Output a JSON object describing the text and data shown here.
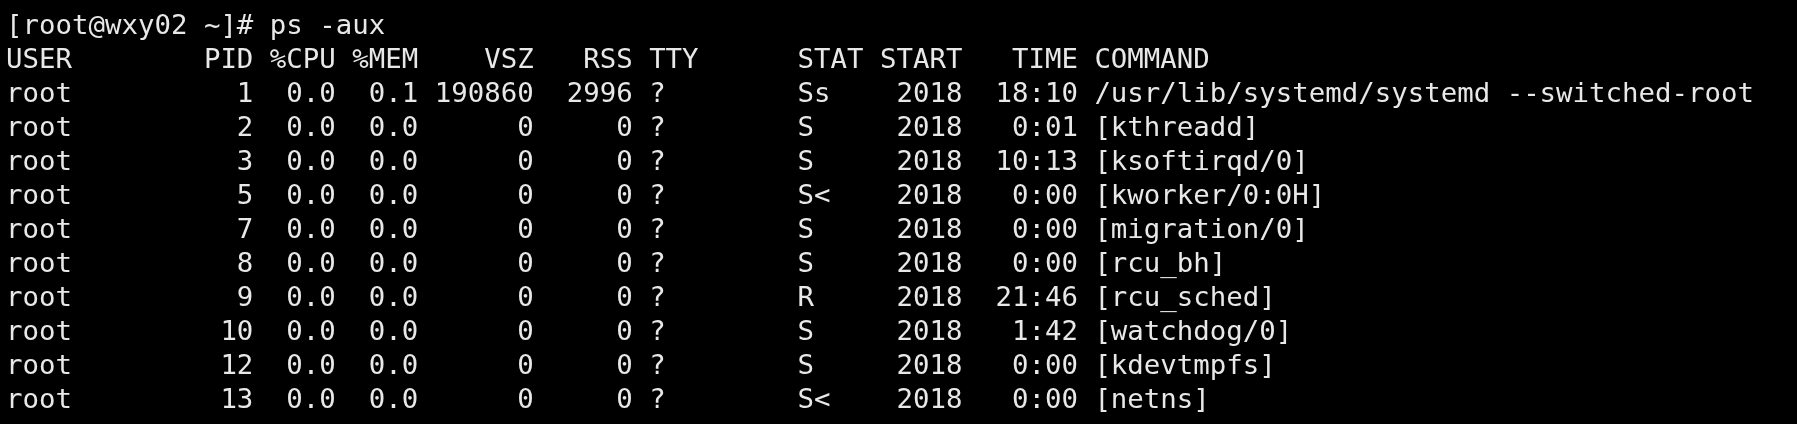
{
  "terminal": {
    "command_line": "[root@wxy02 ~]# ps -aux",
    "header": "USER        PID %CPU %MEM    VSZ   RSS TTY      STAT START   TIME COMMAND",
    "rows": [
      "root          1  0.0  0.1 190860  2996 ?        Ss    2018  18:10 /usr/lib/systemd/systemd --switched-root",
      "root          2  0.0  0.0      0     0 ?        S     2018   0:01 [kthreadd]",
      "root          3  0.0  0.0      0     0 ?        S     2018  10:13 [ksoftirqd/0]",
      "root          5  0.0  0.0      0     0 ?        S<    2018   0:00 [kworker/0:0H]",
      "root          7  0.0  0.0      0     0 ?        S     2018   0:00 [migration/0]",
      "root          8  0.0  0.0      0     0 ?        S     2018   0:00 [rcu_bh]",
      "root          9  0.0  0.0      0     0 ?        R     2018  21:46 [rcu_sched]",
      "root         10  0.0  0.0      0     0 ?        S     2018   1:42 [watchdog/0]",
      "root         12  0.0  0.0      0     0 ?        S     2018   0:00 [kdevtmpfs]",
      "root         13  0.0  0.0      0     0 ?        S<    2018   0:00 [netns]"
    ]
  }
}
